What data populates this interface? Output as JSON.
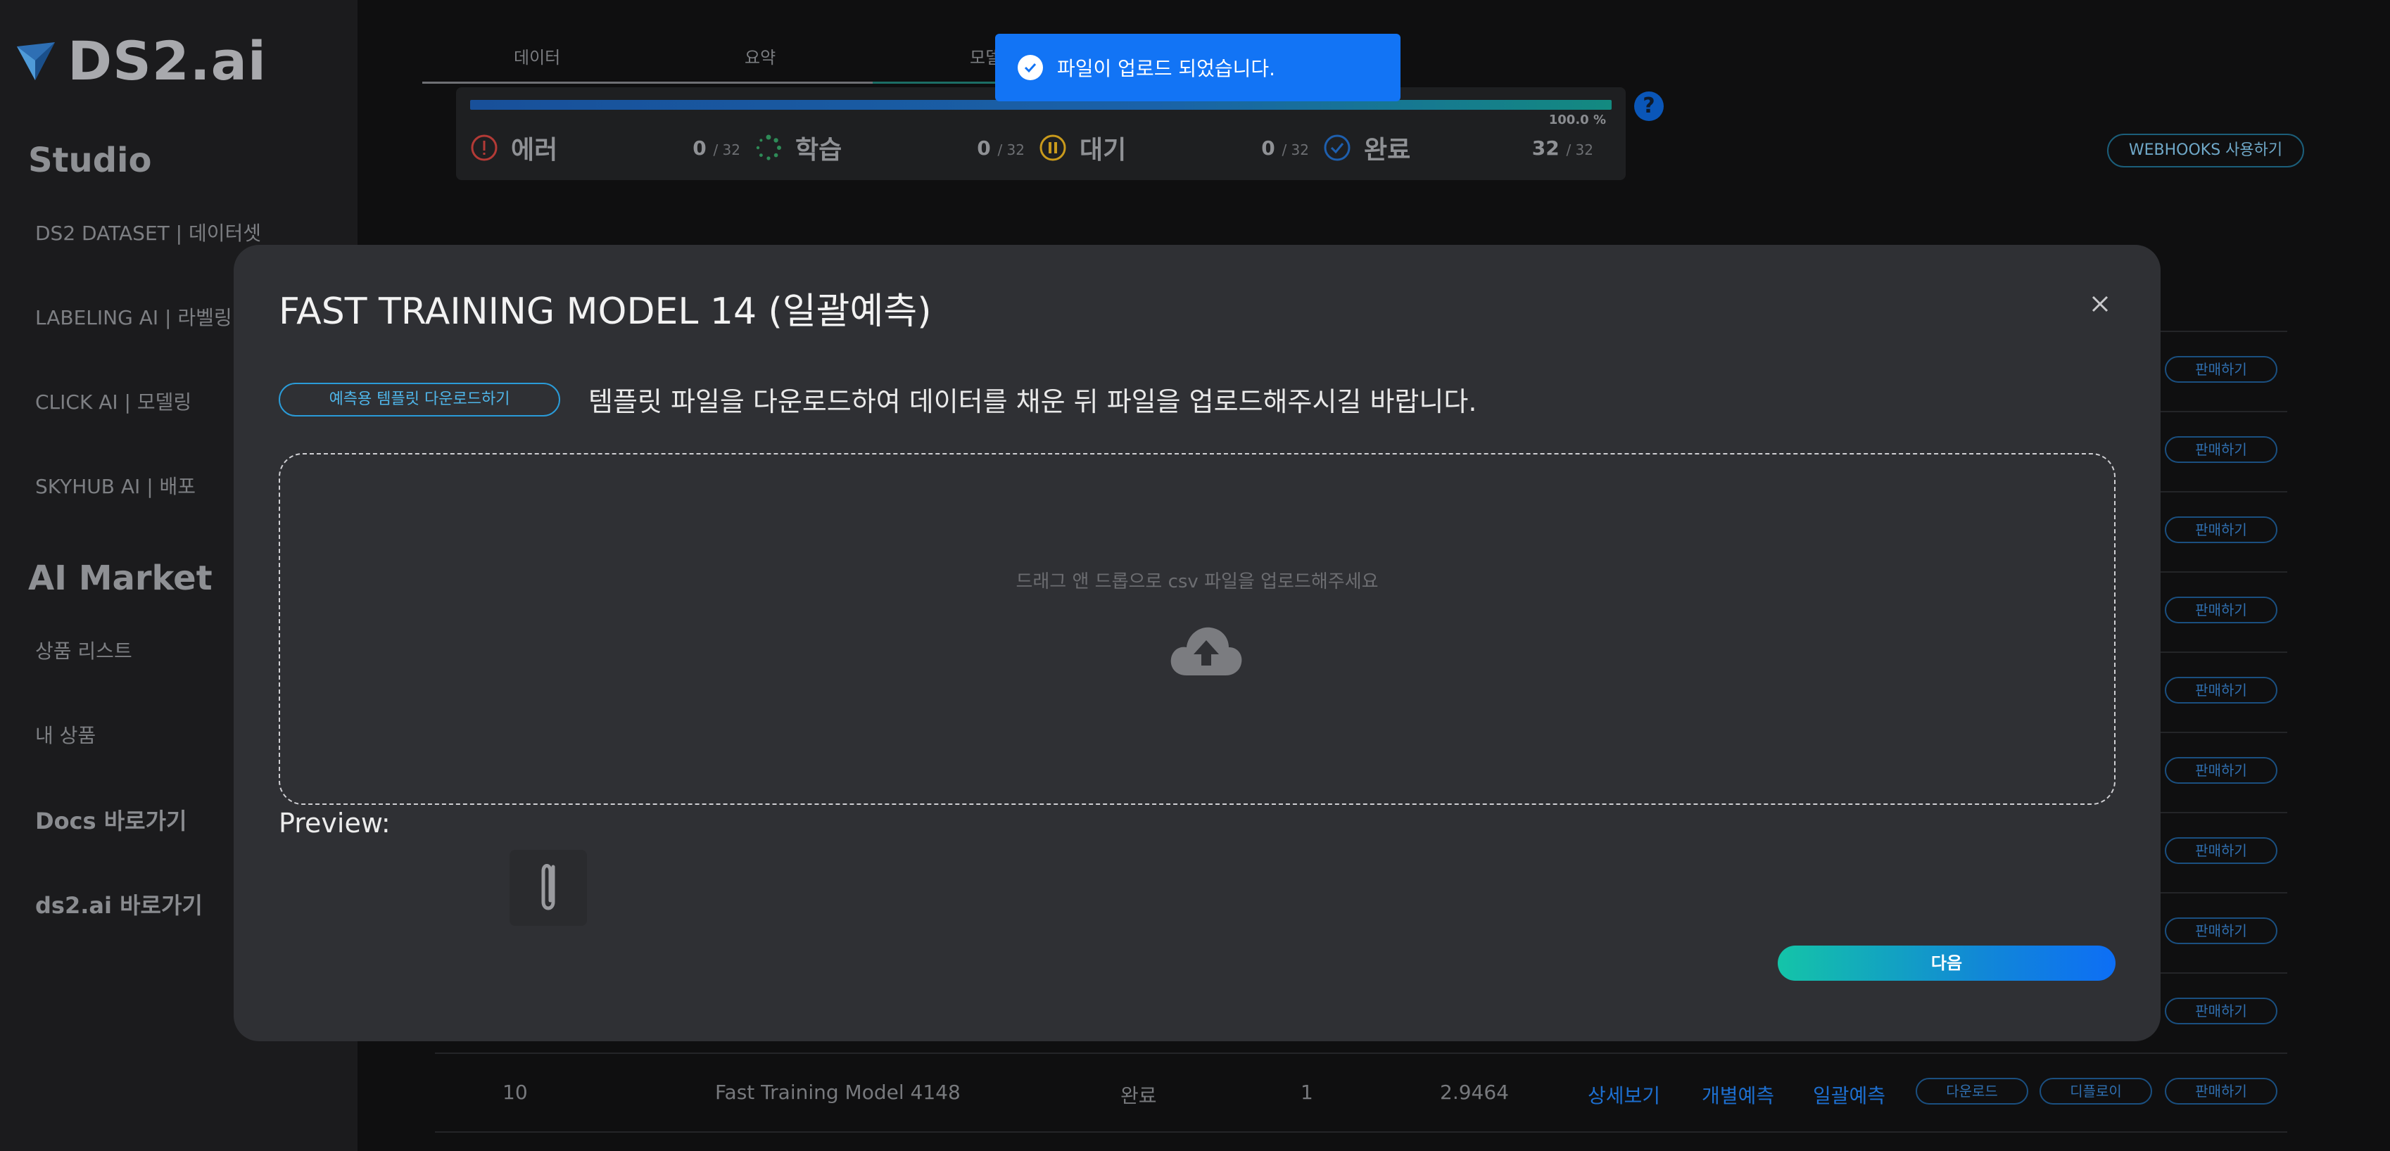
{
  "sidebar": {
    "logo": "DS2.ai",
    "studio_heading": "Studio",
    "studio_items": [
      "DS2 DATASET | 데이터셋",
      "LABELING AI | 라벨링",
      "CLICK AI | 모델링",
      "SKYHUB AI | 배포"
    ],
    "market_heading": "AI Market",
    "market_items": [
      "상품 리스트",
      "내 상품"
    ],
    "links": [
      "Docs 바로가기",
      "ds2.ai 바로가기"
    ]
  },
  "tabs": [
    "데이터",
    "요약",
    "모델"
  ],
  "status": {
    "progress": "100.0 %",
    "progress_value": 1.0,
    "items": [
      {
        "label": "에러",
        "count": "0",
        "total": "/ 32",
        "color": "#c0392b"
      },
      {
        "label": "학습",
        "count": "0",
        "total": "/ 32",
        "color": "#2e8b57"
      },
      {
        "label": "대기",
        "count": "0",
        "total": "/ 32",
        "color": "#d4a017"
      },
      {
        "label": "완료",
        "count": "32",
        "total": "/ 32",
        "color": "#1e6fd0"
      }
    ]
  },
  "help_label": "?",
  "webhooks_label": "WEBHOOKS 사용하기",
  "sell_label": "판매하기",
  "bottom_row": {
    "index": "10",
    "name": "Fast Training Model 4148",
    "status": "완료",
    "epoch": "1",
    "score": "2.9464",
    "detail": "상세보기",
    "single_predict": "개별예측",
    "batch_predict": "일괄예측",
    "download": "다운로드",
    "deploy": "디플로이",
    "sell": "판매하기"
  },
  "toast": {
    "message": "파일이 업로드 되었습니다."
  },
  "modal": {
    "title": "FAST TRAINING MODEL 14 (일괄예측)",
    "template_button": "예측용 템플릿 다운로드하기",
    "instruction": "템플릿 파일을 다운로드하여 데이터를 채운 뒤 파일을 업로드해주시길 바랍니다.",
    "dropzone_text": "드래그 앤 드롭으로 csv 파일을 업로드해주세요",
    "preview_label": "Preview:",
    "next_button": "다음"
  },
  "colors": {
    "accent": "#1274f5",
    "teal": "#14c4a8",
    "modal_bg": "#2f3034"
  }
}
